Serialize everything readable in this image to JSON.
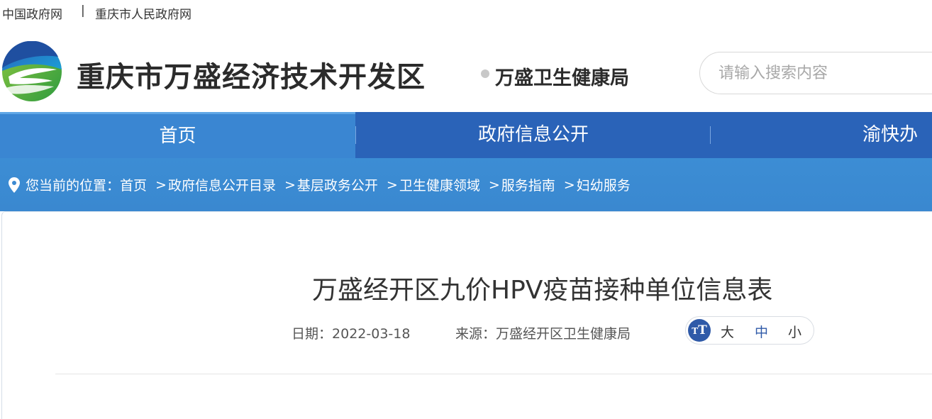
{
  "topbar": {
    "link1": "中国政府网",
    "separator": "|",
    "link2": "重庆市人民政府网"
  },
  "header": {
    "site_title": "重庆市万盛经济技术开发区",
    "department": "万盛卫生健康局",
    "search_placeholder": "请输入搜索内容",
    "logo_icon": "wansheng-logo-icon"
  },
  "nav": {
    "items": [
      {
        "label": "首页"
      },
      {
        "label": "政府信息公开"
      },
      {
        "label": "渝快办"
      }
    ],
    "colors": {
      "bar": "#2a63b8",
      "active": "#3a86d2"
    }
  },
  "breadcrumb": {
    "prefix": "您当前的位置：",
    "items": [
      "首页",
      "政府信息公开目录",
      "基层政务公开",
      "卫生健康领域",
      "服务指南",
      "妇幼服务"
    ],
    "separator": ">",
    "icon": "location-pin-icon"
  },
  "article": {
    "title": "万盛经开区九价HPV疫苗接种单位信息表",
    "date_label": "日期：",
    "date": "2022-03-18",
    "source_label": "来源：",
    "source": "万盛经开区卫生健康局"
  },
  "font_size": {
    "icon_text": "T",
    "large": "大",
    "medium": "中",
    "small": "小",
    "accent": "#2f5aa8"
  }
}
